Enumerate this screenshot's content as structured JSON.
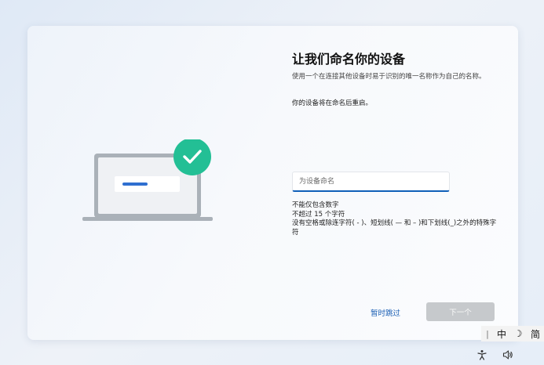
{
  "page": {
    "title": "让我们命名你的设备",
    "description": "使用一个在连接其他设备时易于识别的唯一名称作为自己的名称。",
    "restart_note": "你的设备将在命名后重启。"
  },
  "device_name_input": {
    "placeholder": "为设备命名",
    "value": ""
  },
  "rules": [
    "不能仅包含数字",
    "不超过 15 个字符",
    "没有空格或除连字符( - )、短划线( — 和 – )和下划线(_)之外的特殊字符"
  ],
  "actions": {
    "skip_label": "暂时跳过",
    "next_label": "下一个"
  },
  "ime_toolbar": {
    "handle": "|",
    "mode": "中",
    "shape": "☽",
    "script": "简"
  },
  "colors": {
    "accent": "#0f5fb8",
    "link": "#1a5fb4",
    "check_badge": "#1fb98f",
    "disabled_button": "#c6c9cc"
  },
  "icons": {
    "laptop": "laptop-illustration",
    "check": "check-icon",
    "accessibility": "accessibility-icon",
    "volume": "volume-icon"
  }
}
